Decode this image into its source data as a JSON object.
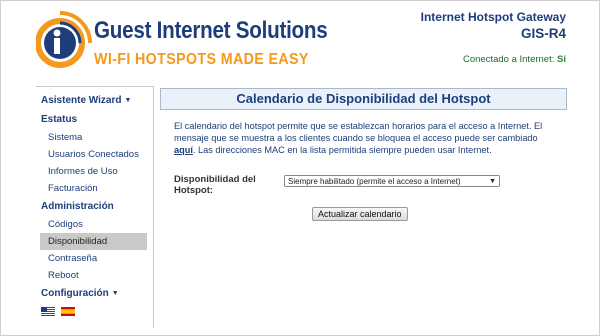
{
  "header": {
    "brand_name": "Guest Internet Solutions",
    "tagline": "WI-FI HOTSPOTS MADE EASY",
    "gateway_title": "Internet Hotspot Gateway",
    "gateway_model": "GIS-R4",
    "connection_label": "Conectado a Internet:",
    "connection_value": "Si"
  },
  "sidebar": {
    "sections": [
      {
        "label": "Asistente Wizard",
        "icon": "double-chevron-down-icon"
      },
      {
        "label": "Estatus"
      },
      {
        "label": "Administración"
      },
      {
        "label": "Configuración",
        "icon": "double-chevron-down-icon"
      }
    ],
    "status_items": [
      "Sistema",
      "Usuarios Conectados",
      "Informes de Uso",
      "Facturación"
    ],
    "admin_items": [
      "Códigos",
      "Disponibilidad",
      "Contraseña",
      "Reboot"
    ],
    "active_item": "Disponibilidad",
    "flags": [
      "us-flag-icon",
      "spain-flag-icon"
    ]
  },
  "main": {
    "title": "Calendario de Disponibilidad del Hotspot",
    "description_part1": "El calendario del hotspot permite que se establezcan horarios para el acceso a Internet. El mensaje que se muestra a los clientes cuando se bloquea el acceso puede ser cambiado",
    "description_link": "aquí",
    "description_part2": ". Las direcciones MAC en la lista permitida siempre pueden usar Internet.",
    "availability_label": "Disponibilidad del Hotspot:",
    "availability_selected": "Siempre habilitado (permite el acceso a Internet)",
    "update_button": "Actualizar calendario"
  },
  "colors": {
    "brand_blue": "#1d3e7a",
    "accent_orange": "#f39a1e",
    "status_green": "#2a8a2a",
    "title_bg": "#e9f2fb"
  }
}
